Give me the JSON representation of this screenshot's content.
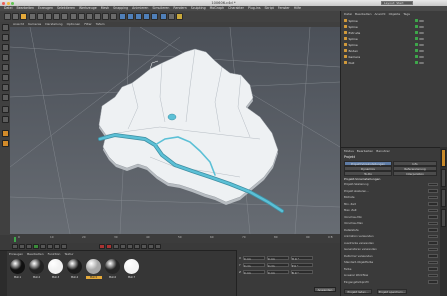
{
  "window": {
    "title": "100606.c4d *",
    "layout_label": "Layout:",
    "layout_value": "Start"
  },
  "menubar": [
    "Datei",
    "Bearbeiten",
    "Erzeugen",
    "Selektieren",
    "Werkzeuge",
    "Mesh",
    "Snapping",
    "Animieren",
    "Simulieren",
    "Rendern",
    "Sculpting",
    "MoGraph",
    "Charakter",
    "Plug-ins",
    "Skript",
    "Fenster",
    "Hilfe"
  ],
  "viewport_menu": [
    "Ansicht",
    "Kameras",
    "Darstellung",
    "Optionen",
    "Filter",
    "Tafeln"
  ],
  "timeline": {
    "ticks": [
      "0",
      "10",
      "20",
      "30",
      "40",
      "50",
      "60",
      "70",
      "80",
      "90"
    ],
    "end_label": "0 B"
  },
  "materials": {
    "menu": [
      "Erzeugen",
      "Bearbeiten",
      "Funktion",
      "Textur"
    ],
    "items": [
      {
        "label": "Mat.1",
        "color": "#111111"
      },
      {
        "label": "Mat.2",
        "color": "#222222"
      },
      {
        "label": "Mat.3",
        "color": "#f2f2f2"
      },
      {
        "label": "Mat.4",
        "color": "#1a1a1a"
      },
      {
        "label": "Mat.5",
        "color": "#a8a8a8"
      },
      {
        "label": "Mat.6",
        "color": "#262626"
      },
      {
        "label": "Mat.7",
        "color": "#f5f5f5"
      }
    ]
  },
  "coordinates": {
    "rows": [
      {
        "axis": "X",
        "pos": "0 cm",
        "size": "0 cm",
        "rot": "H 0 °"
      },
      {
        "axis": "Y",
        "pos": "0 cm",
        "size": "0 cm",
        "rot": "P 0 °"
      },
      {
        "axis": "Z",
        "pos": "0 cm",
        "size": "0 cm",
        "rot": "B 0 °"
      }
    ],
    "apply_label": "Anwenden"
  },
  "object_panel": {
    "menu": [
      "Datei",
      "Bearbeiten",
      "Ansicht",
      "Objekte",
      "Tags"
    ],
    "objects": [
      "Spline",
      "Spline",
      "Extrude",
      "Spline",
      "Spline",
      "Boden",
      "Kamera",
      "Null"
    ]
  },
  "attribute_panel": {
    "menu": [
      "Modus",
      "Bearbeiten",
      "Benutzer"
    ],
    "section_title": "Projekt",
    "tabs": [
      "Projekt-Voreinstellungen",
      "Info",
      "Dynamics",
      "Referenzierung",
      "To-Do",
      "Interpolation"
    ],
    "heading": "Projekt-Voreinstellungen",
    "rows": [
      "Projekt-Skalierung",
      "Projekt skalieren...",
      "Bildrate",
      "Min. Zeit",
      "Max. Zeit",
      "Vorschau-Min",
      "Vorschau-Max",
      "Detailstufe",
      "Animation verwenden",
      "Ausdrücke verwenden",
      "Generatoren verwenden",
      "Deformer verwenden",
      "Standard-Objektfarbe",
      "Farbe",
      "Linearer Workflow",
      "Eingangsfarbprofil"
    ],
    "bottom_buttons": [
      "Projekt laden...",
      "Projekt speichern..."
    ]
  },
  "colors": {
    "accent": "#e4a93a",
    "map_fill": "#eef1f3",
    "river": "#4fb3c9",
    "active_tab": "#5f7ca5"
  }
}
